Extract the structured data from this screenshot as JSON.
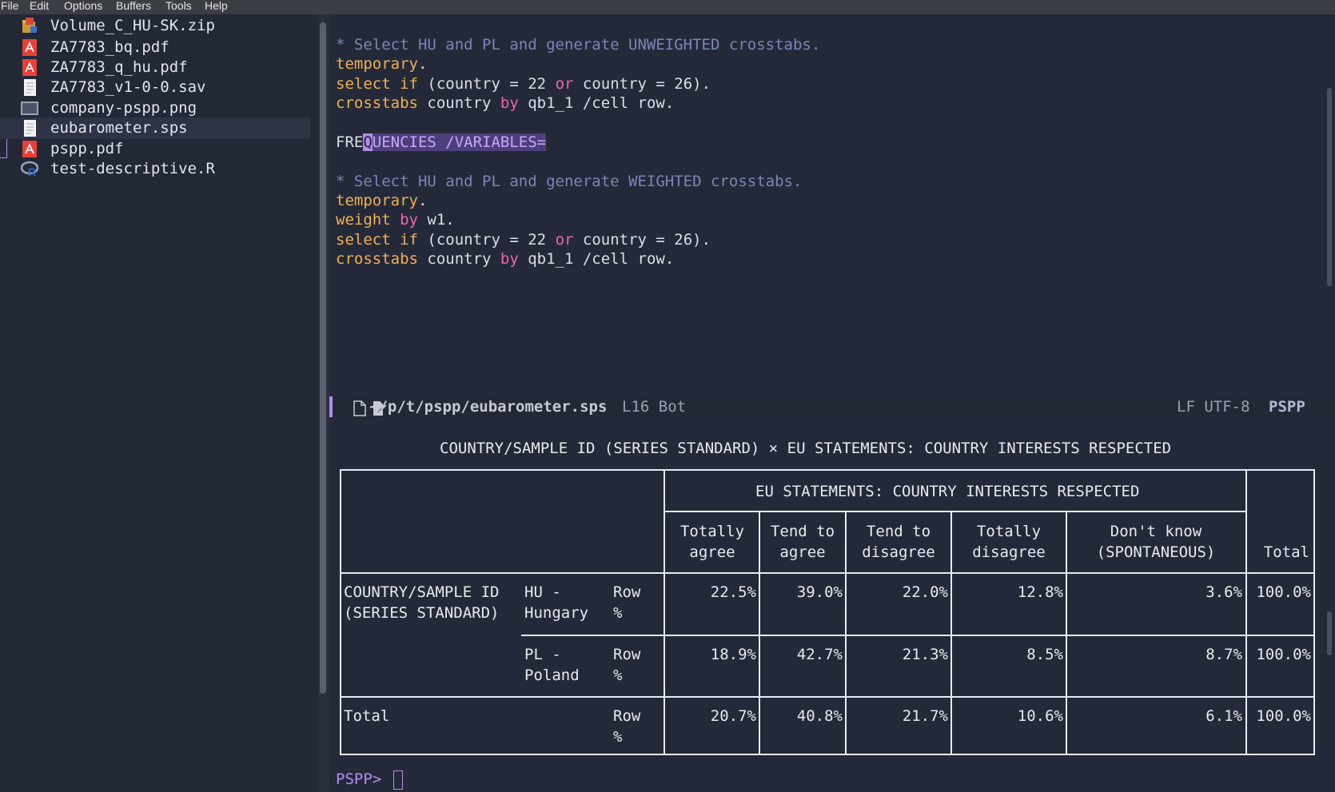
{
  "menubar": [
    "File",
    "Edit",
    "Options",
    "Buffers",
    "Tools",
    "Help"
  ],
  "sidebar": {
    "files": [
      {
        "name": "Volume_C_HU-SK.zip",
        "icon": "zip-archive-icon"
      },
      {
        "name": "ZA7783_bq.pdf",
        "icon": "pdf-icon"
      },
      {
        "name": "ZA7783_q_hu.pdf",
        "icon": "pdf-icon"
      },
      {
        "name": "ZA7783_v1-0-0.sav",
        "icon": "document-icon"
      },
      {
        "name": "company-pspp.png",
        "icon": "image-icon"
      },
      {
        "name": "eubarometer.sps",
        "icon": "document-icon",
        "selected": true
      },
      {
        "name": "pspp.pdf",
        "icon": "pdf-icon"
      },
      {
        "name": "test-descriptive.R",
        "icon": "r-language-icon"
      }
    ]
  },
  "editor": {
    "c1": "* Select HU and PL and generate UNWEIGHTED crosstabs.",
    "t1": "temporary",
    "s1a": "select if",
    "s1b": "(country = 22 ",
    "s1c": "or",
    "s1d": " country = 26).",
    "x1a": "crosstabs",
    "x1b": " country ",
    "x1c": "by",
    "x1d": " qb1_1 /cell row.",
    "f_pre": "FRE",
    "f_cur": "Q",
    "f_sel": "UENCIES /VARIABLES=",
    "c2": "* Select HU and PL and generate WEIGHTED crosstabs.",
    "t2": "temporary",
    "w2a": "weight",
    "w2b": "by",
    "w2c": " w1.",
    "s2a": "select if",
    "s2b": "(country = 22 ",
    "s2c": "or",
    "s2d": " country = 26).",
    "x2a": "crosstabs",
    "x2b": " country ",
    "x2c": "by",
    "x2d": " qb1_1 /cell row.",
    "dot": "."
  },
  "modeline": {
    "path": "~/p/t/pspp/eubarometer.sps",
    "position": "L16 Bot",
    "encoding": "LF UTF-8",
    "mode": "PSPP"
  },
  "output": {
    "title": "COUNTRY/SAMPLE ID (SERIES STANDARD) × EU STATEMENTS: COUNTRY INTERESTS RESPECTED",
    "group_header": "EU STATEMENTS: COUNTRY INTERESTS RESPECTED",
    "col_headers": [
      [
        "Totally",
        "agree"
      ],
      [
        "Tend to",
        "agree"
      ],
      [
        "Tend to",
        "disagree"
      ],
      [
        "Totally",
        "disagree"
      ],
      [
        "Don't know",
        "(SPONTANEOUS)"
      ],
      [
        "Total"
      ]
    ],
    "row_var": [
      "COUNTRY/SAMPLE ID",
      "(SERIES STANDARD)"
    ],
    "rows": [
      {
        "label": [
          "HU -",
          "Hungary"
        ],
        "stat": [
          "Row",
          "%"
        ],
        "values": [
          "22.5%",
          "39.0%",
          "22.0%",
          "12.8%",
          "3.6%",
          "100.0%"
        ]
      },
      {
        "label": [
          "PL -",
          "Poland"
        ],
        "stat": [
          "Row",
          "%"
        ],
        "values": [
          "18.9%",
          "42.7%",
          "21.3%",
          "8.5%",
          "8.7%",
          "100.0%"
        ]
      }
    ],
    "total_row": {
      "label": "Total",
      "stat": [
        "Row",
        "%"
      ],
      "values": [
        "20.7%",
        "40.8%",
        "21.7%",
        "10.6%",
        "6.1%",
        "100.0%"
      ]
    },
    "prompt": "PSPP>"
  }
}
